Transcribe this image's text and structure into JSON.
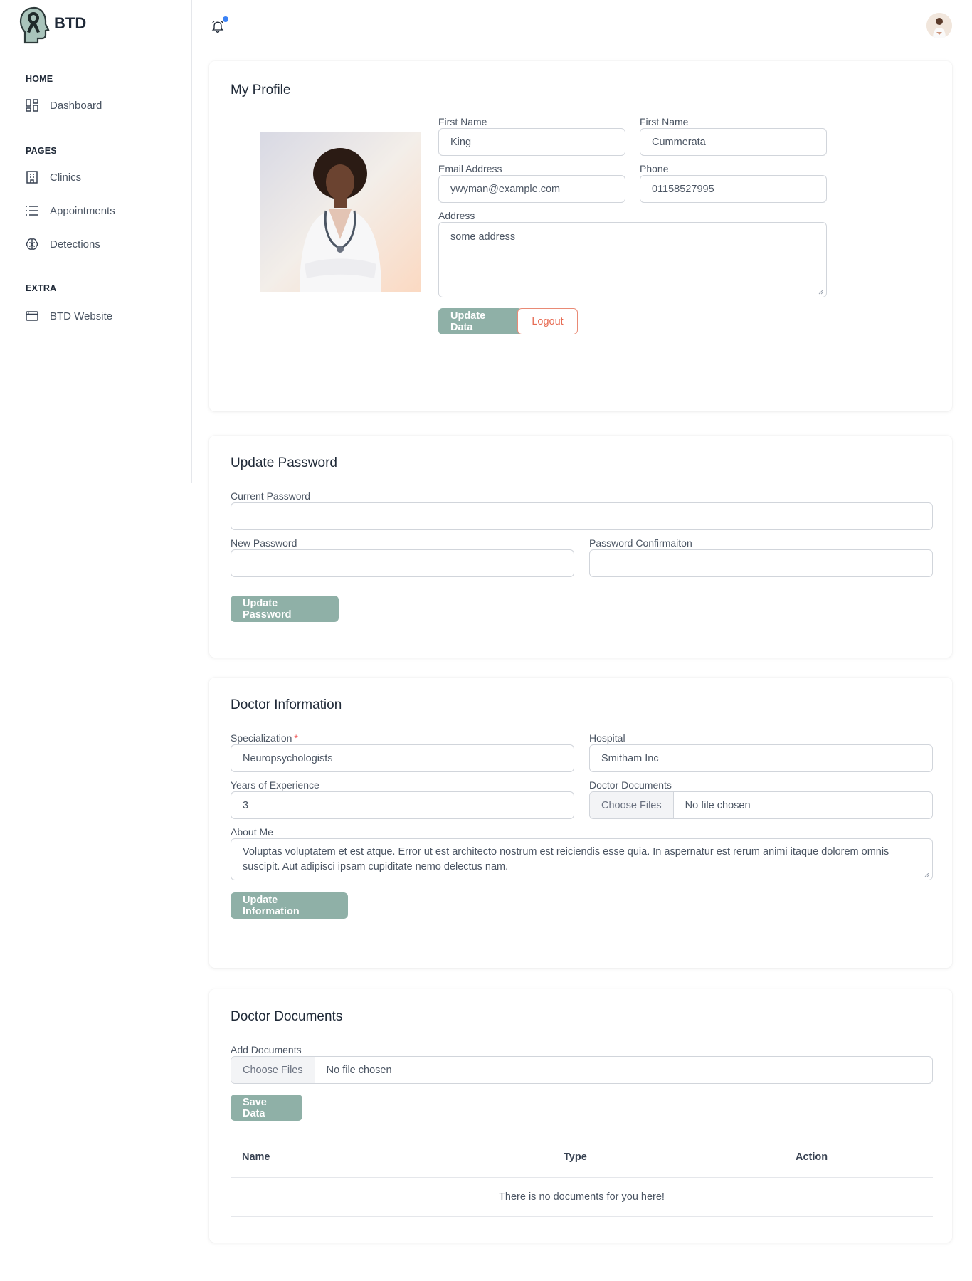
{
  "brand": {
    "name": "BTD"
  },
  "sidebar": {
    "sections": [
      {
        "title": "HOME",
        "items": [
          {
            "label": "Dashboard",
            "icon": "dashboard-icon"
          }
        ]
      },
      {
        "title": "PAGES",
        "items": [
          {
            "label": "Clinics",
            "icon": "building-icon"
          },
          {
            "label": "Appointments",
            "icon": "list-icon"
          },
          {
            "label": "Detections",
            "icon": "brain-icon"
          }
        ]
      },
      {
        "title": "EXTRA",
        "items": [
          {
            "label": "BTD Website",
            "icon": "browser-icon"
          }
        ]
      }
    ]
  },
  "colors": {
    "accent": "#8fb0a7",
    "logout": "#e76b53",
    "notification_dot": "#3b82f6",
    "required": "#ef4444"
  },
  "profile": {
    "title": "My Profile",
    "first_name_label": "First Name",
    "first_name": "King",
    "last_name_label": "First Name",
    "last_name": "Cummerata",
    "email_label": "Email Address",
    "email": "ywyman@example.com",
    "phone_label": "Phone",
    "phone": "01158527995",
    "address_label": "Address",
    "address": "some address",
    "update_button": "Update Data",
    "logout_button": "Logout"
  },
  "password": {
    "title": "Update Password",
    "current_label": "Current Password",
    "new_label": "New Password",
    "confirm_label": "Password Confirmaiton",
    "update_button": "Update Password"
  },
  "doctor": {
    "title": "Doctor Information",
    "specialization_label": "Specialization",
    "specialization": "Neuropsychologists",
    "hospital_label": "Hospital",
    "hospital": "Smitham Inc",
    "experience_label": "Years of Experience",
    "experience": "3",
    "documents_label": "Doctor Documents",
    "choose_files": "Choose Files",
    "no_file": "No file chosen",
    "about_label": "About Me",
    "about": "Voluptas voluptatem et est atque. Error ut est architecto nostrum est reiciendis esse quia. In aspernatur est rerum animi itaque dolorem omnis suscipit. Aut adipisci ipsam cupiditate nemo delectus nam.",
    "update_button": "Update Information"
  },
  "documents": {
    "title": "Doctor Documents",
    "add_label": "Add Documents",
    "choose_files": "Choose Files",
    "no_file": "No file chosen",
    "save_button": "Save Data",
    "columns": [
      "Name",
      "Type",
      "Action"
    ],
    "empty_message": "There is no documents for you here!"
  }
}
